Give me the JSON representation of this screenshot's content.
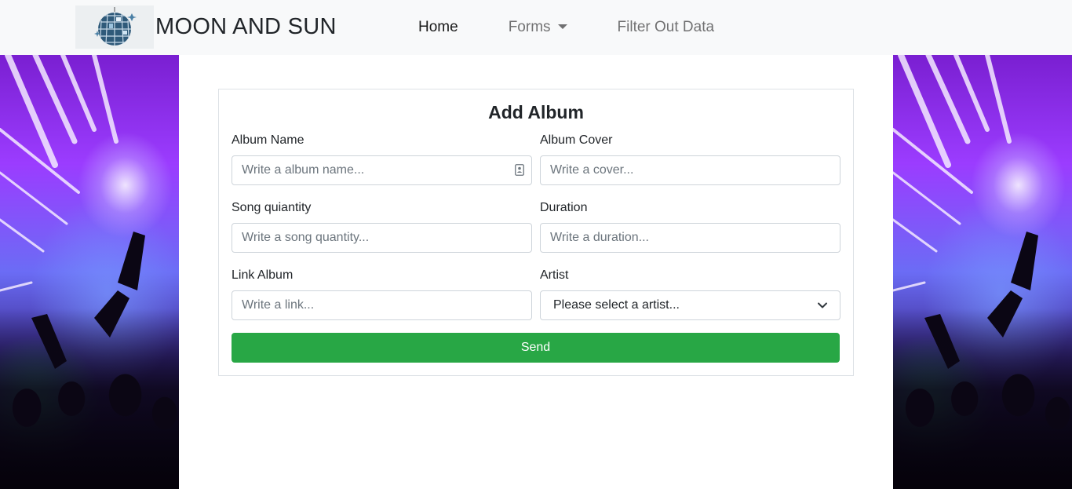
{
  "brand": {
    "name": "MOON AND SUN",
    "logo_icon": "disco-ball-icon"
  },
  "nav": {
    "items": [
      {
        "label": "Home",
        "active": true
      },
      {
        "label": "Forms",
        "dropdown": true
      },
      {
        "label": "Filter Out Data"
      }
    ]
  },
  "form": {
    "title": "Add Album",
    "fields": {
      "album_name": {
        "label": "Album Name",
        "placeholder": "Write a album name..."
      },
      "album_cover": {
        "label": "Album Cover",
        "placeholder": "Write a cover..."
      },
      "song_quantity": {
        "label": "Song quiantity",
        "placeholder": "Write a song quantity..."
      },
      "duration": {
        "label": "Duration",
        "placeholder": "Write a duration..."
      },
      "link_album": {
        "label": "Link Album",
        "placeholder": "Write a link..."
      },
      "artist": {
        "label": "Artist",
        "selected": "Please select a artist..."
      }
    },
    "submit_label": "Send"
  },
  "colors": {
    "navbar_bg": "#f8f9fa",
    "send_button": "#28a745",
    "input_border": "#ced4da"
  }
}
